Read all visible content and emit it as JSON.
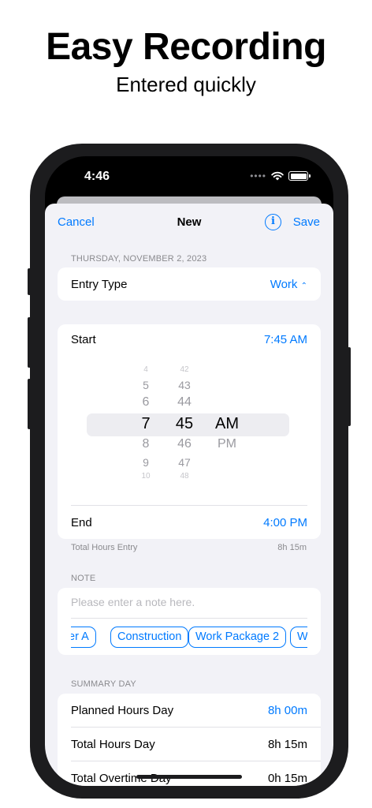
{
  "headline": "Easy Recording",
  "subline": "Entered quickly",
  "status": {
    "time": "4:46",
    "dots": "••••"
  },
  "nav": {
    "cancel": "Cancel",
    "title": "New",
    "info_icon": "i",
    "save": "Save"
  },
  "date_header": "THURSDAY, NOVEMBER 2, 2023",
  "entry_type": {
    "label": "Entry Type",
    "value": "Work",
    "chevron": "⌃⌄"
  },
  "start": {
    "label": "Start",
    "value": "7:45 AM"
  },
  "picker": {
    "hours": [
      "4",
      "5",
      "6",
      "7",
      "8",
      "9",
      "10"
    ],
    "minutes": [
      "42",
      "43",
      "44",
      "45",
      "46",
      "47",
      "48"
    ],
    "periods": [
      "AM",
      "PM"
    ]
  },
  "end": {
    "label": "End",
    "value": "4:00 PM"
  },
  "total_entry": {
    "label": "Total Hours Entry",
    "value": "8h 15m"
  },
  "note": {
    "section": "NOTE",
    "placeholder": "Please enter a note here.",
    "chips": [
      "er A",
      "Construction",
      "Work Package 2",
      "W"
    ]
  },
  "summary": {
    "section": "SUMMARY DAY",
    "rows": [
      {
        "label": "Planned Hours Day",
        "value": "8h 00m"
      },
      {
        "label": "Total Hours Day",
        "value": "8h 15m"
      },
      {
        "label": "Total Overtime Day",
        "value": "0h 15m"
      }
    ]
  },
  "colors": {
    "accent": "#007aff",
    "background": "#f2f2f7",
    "frame": "#1c1c1e"
  }
}
